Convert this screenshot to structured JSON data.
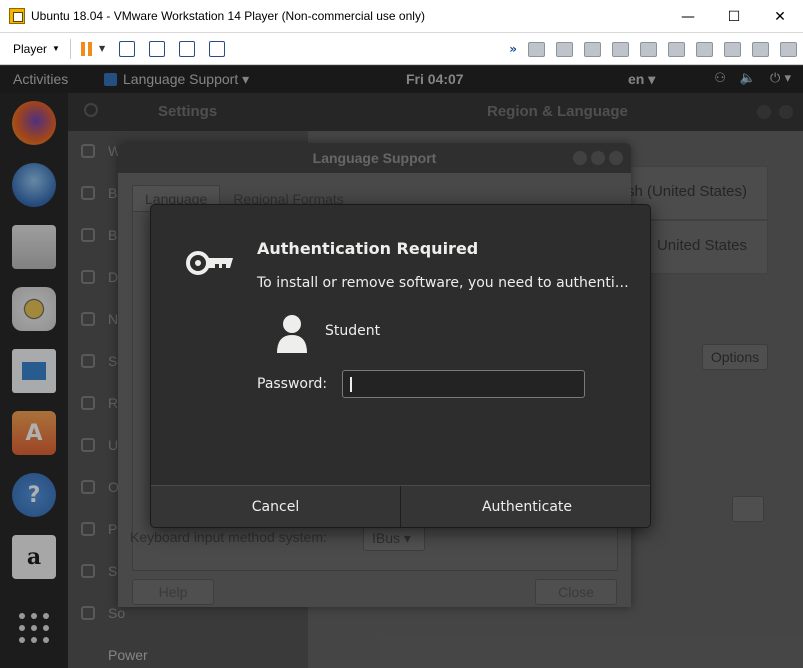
{
  "window": {
    "title": "Ubuntu 18.04 - VMware Workstation 14 Player (Non-commercial use only)",
    "minimize": "—",
    "maximize": "☐",
    "close": "✕"
  },
  "toolbar": {
    "player_label": "Player"
  },
  "topbar": {
    "activities": "Activities",
    "app_menu": "Language Support ▾",
    "clock": "Fri 04:07",
    "language": "en ▾"
  },
  "dock": {
    "amazon_glyph": "a"
  },
  "settings": {
    "search_title": "Settings",
    "panel_title": "Region & Language",
    "side_items": [
      {
        "label": "W"
      },
      {
        "label": "B"
      },
      {
        "label": "B"
      },
      {
        "label": "D"
      },
      {
        "label": "N"
      },
      {
        "label": "Se"
      },
      {
        "label": "R"
      },
      {
        "label": "U"
      },
      {
        "label": "O"
      },
      {
        "label": "P"
      },
      {
        "label": "Sh"
      },
      {
        "label": "So"
      },
      {
        "label": "Power"
      }
    ],
    "language_value": "sh (United States)",
    "formats_value": "United States",
    "options_label": "Options"
  },
  "language_support": {
    "title": "Language Support",
    "tabs": [
      "Language",
      "Regional Formats"
    ],
    "keyboard_label": "Keyboard input method system:",
    "keyboard_value": "IBus ▾",
    "help_label": "Help",
    "close_label": "Close"
  },
  "auth": {
    "title": "Authentication Required",
    "message": "To install or remove software, you need to authenti…",
    "user": "Student",
    "password_label": "Password:",
    "password_value": "",
    "cancel_label": "Cancel",
    "authenticate_label": "Authenticate"
  }
}
